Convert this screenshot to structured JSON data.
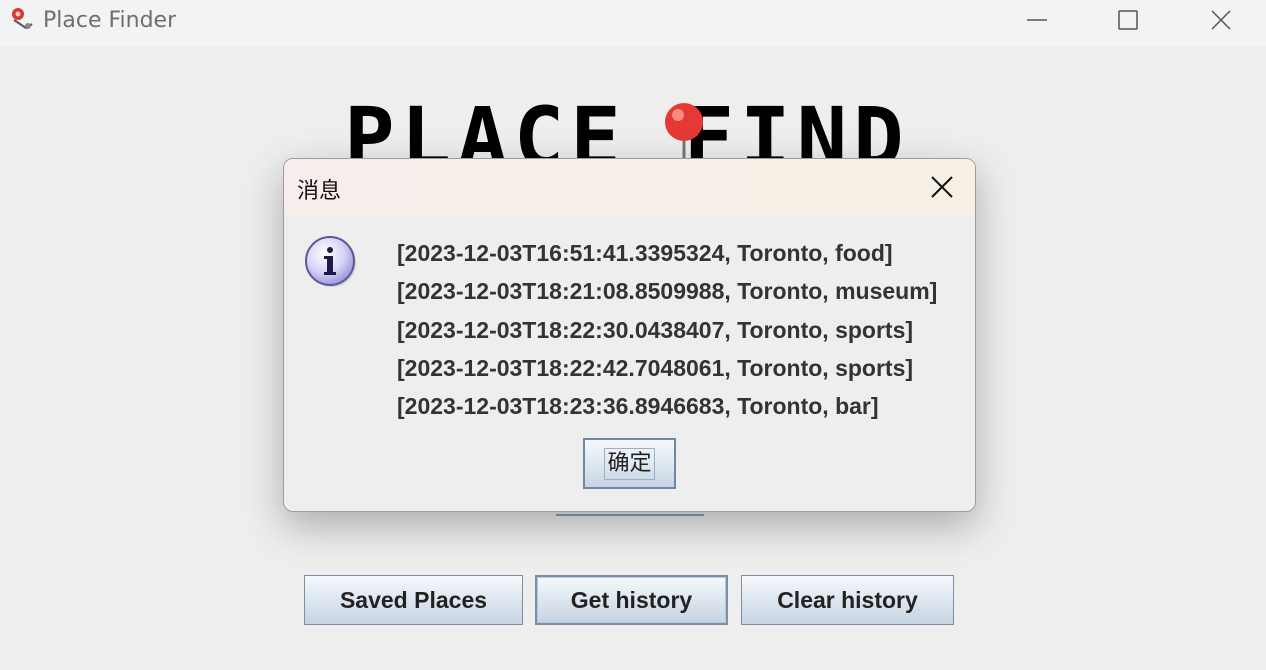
{
  "window": {
    "title": "Place Finder"
  },
  "logo": {
    "text": "PLACE FINDER"
  },
  "buttons": {
    "saved_places": "Saved Places",
    "get_history": "Get history",
    "clear_history": "Clear history"
  },
  "dialog": {
    "title": "消息",
    "messages": [
      "[2023-12-03T16:51:41.3395324, Toronto, food]",
      "[2023-12-03T18:21:08.8509988, Toronto, museum]",
      "[2023-12-03T18:22:30.0438407, Toronto, sports]",
      "[2023-12-03T18:22:42.7048061, Toronto, sports]",
      "[2023-12-03T18:23:36.8946683, Toronto, bar]"
    ],
    "ok_label": "确定"
  },
  "icons": {
    "app": "app-logo-icon",
    "info": "info-icon",
    "minimize": "minimize-icon",
    "maximize": "maximize-icon",
    "close": "close-icon",
    "pin": "map-pin-icon"
  },
  "colors": {
    "window_bg": "#eeeeee",
    "button_border": "#7a8fa8",
    "pin_red": "#e53935",
    "info_purple": "#c9c6f2"
  }
}
